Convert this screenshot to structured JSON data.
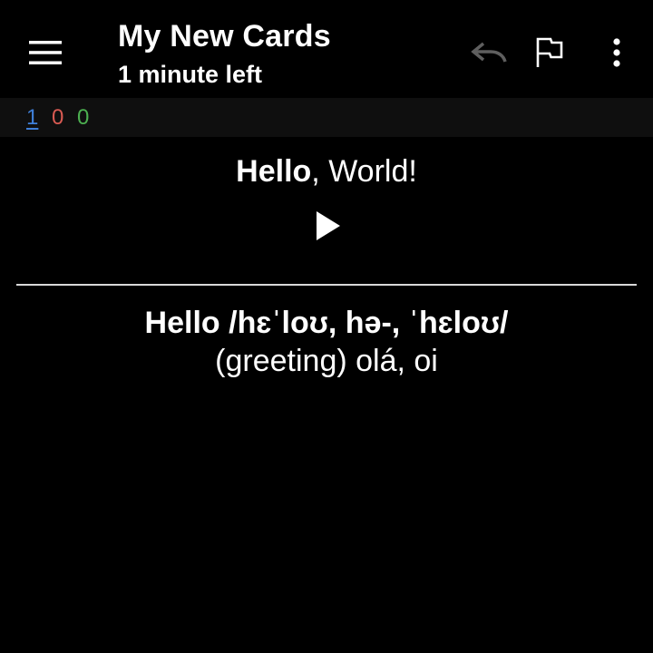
{
  "toolbar": {
    "title": "My New Cards",
    "subtitle": "1 minute left",
    "icons": {
      "menu": "hamburger-menu-icon",
      "undo": "undo-icon",
      "flag": "flag-icon",
      "more": "more-vertical-icon"
    }
  },
  "counts": {
    "new": "1",
    "learning": "0",
    "review": "0"
  },
  "card": {
    "question_bold": "Hello",
    "question_rest": ", World!",
    "play_icon": "play-icon",
    "answer_headword": "Hello /hɛˈloʊ, hə-, ˈhɛloʊ/",
    "answer_definition": "(greeting) olá, oi"
  },
  "colors": {
    "background": "#000000",
    "text": "#ffffff",
    "count_new": "#3f7fd8",
    "count_learning": "#d85a52",
    "count_review": "#4caf50",
    "undo_disabled": "#5f5f5f",
    "counts_bar": "#0f0f0f"
  }
}
